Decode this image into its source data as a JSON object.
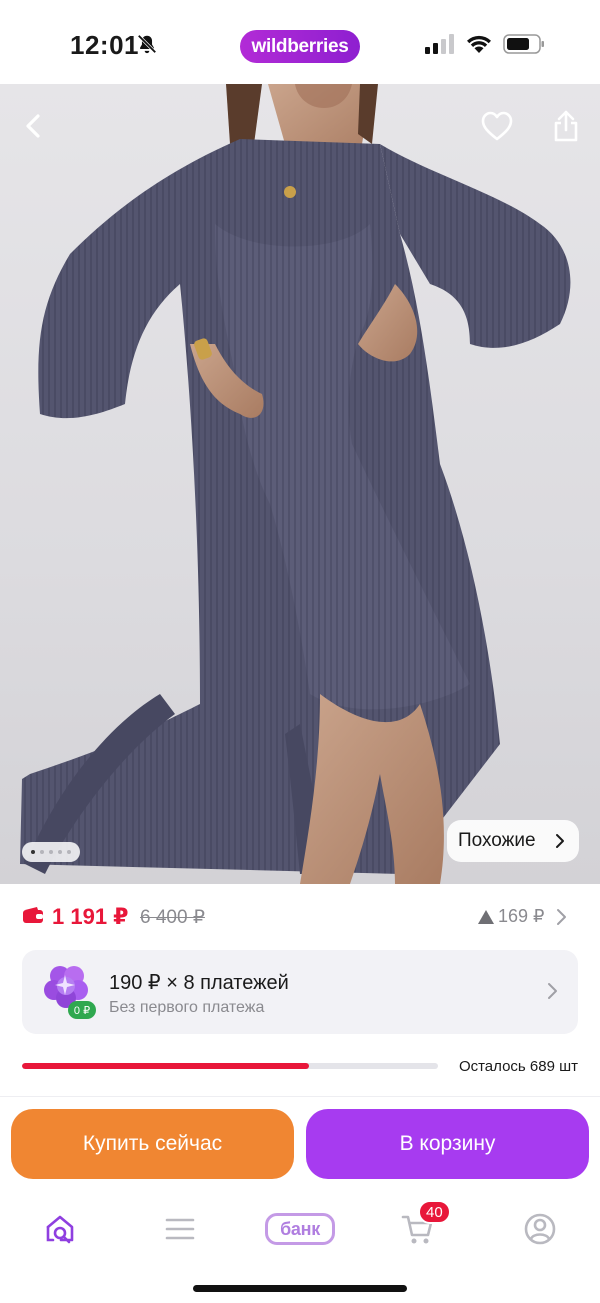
{
  "status_bar": {
    "time": "12:01",
    "brand": "wildberries",
    "icons": [
      "bell-off-icon",
      "signal-icon",
      "wifi-icon",
      "battery-icon"
    ]
  },
  "product": {
    "image_alt": "ribbed robe and dress set",
    "gallery": {
      "count": 5,
      "active": 0
    },
    "similar_label": "Похожие",
    "icons": [
      "back-arrow-icon",
      "heart-icon",
      "share-icon"
    ]
  },
  "price": {
    "current": "1 191 ₽",
    "old": "6 400 ₽",
    "drop": "169 ₽",
    "current_color": "#e8173a"
  },
  "installment": {
    "badge": "0 ₽",
    "title": "190 ₽ × 8 платежей",
    "subtitle": "Без первого платежа"
  },
  "stock": {
    "fill_percent": 69,
    "text": "Осталось 689 шт"
  },
  "actions": {
    "buy_now": "Купить сейчас",
    "to_cart": "В корзину",
    "buy_color": "#f08632",
    "cart_color": "#a73bf0"
  },
  "nav": {
    "bank_label": "банк",
    "cart_count": "40",
    "icons": [
      "home-search-icon",
      "catalog-menu-icon",
      "bank-icon",
      "cart-icon",
      "profile-icon"
    ]
  }
}
